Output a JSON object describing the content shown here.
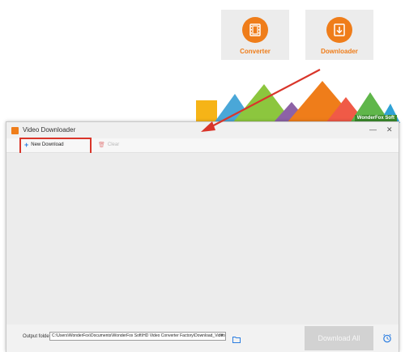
{
  "launcher": {
    "converter_label": "Converter",
    "downloader_label": "Downloader"
  },
  "banner": {
    "brand": "WonderFox Soft"
  },
  "window": {
    "title": "Video Downloader",
    "minimize_glyph": "—",
    "close_glyph": "✕"
  },
  "toolbar": {
    "new_download": "New Download",
    "clear": "Clear"
  },
  "footer": {
    "output_label": "Output folder:",
    "output_path": "C:\\Users\\WonderFox\\Documents\\WonderFox Soft\\HD Video Converter Factory\\Download_Video\\",
    "download_all": "Download All"
  },
  "colors": {
    "accent": "#ef7d1a",
    "highlight": "#d9352a",
    "link_blue": "#2a7de1"
  },
  "icons": [
    "film-icon",
    "download-film-icon",
    "plus-icon",
    "trash-icon",
    "folder-icon",
    "alarm-clock-icon",
    "minimize-icon",
    "close-icon"
  ]
}
